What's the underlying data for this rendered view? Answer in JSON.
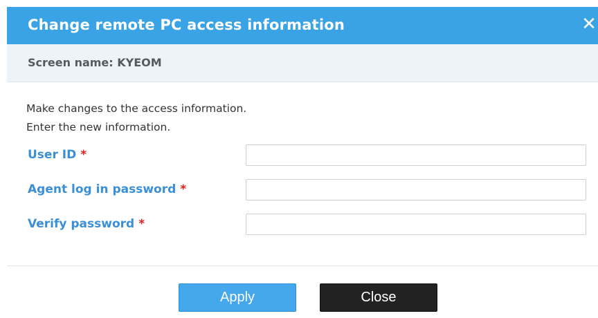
{
  "dialog": {
    "title": "Change remote PC access information",
    "close_glyph": "✕",
    "close_icon": "close-icon",
    "screen_name": "Screen name: KYEOM",
    "instructions": [
      "Make changes to the access information.",
      "Enter the new information."
    ],
    "fields": [
      {
        "label": "User ID",
        "required_mark": "*",
        "value": "",
        "placeholder": ""
      },
      {
        "label": "Agent log in password",
        "required_mark": "*",
        "value": "",
        "placeholder": ""
      },
      {
        "label": "Verify password",
        "required_mark": "*",
        "value": "",
        "placeholder": ""
      }
    ],
    "buttons": {
      "apply_label": "Apply",
      "close_label": "Close"
    }
  },
  "colors": {
    "title_bar": "#3aa3e6",
    "subheader_bg": "#eef3f8",
    "label_blue": "#3a8fd6",
    "required_red": "#e02020",
    "apply_button": "#45a7ec",
    "close_button": "#222222"
  }
}
